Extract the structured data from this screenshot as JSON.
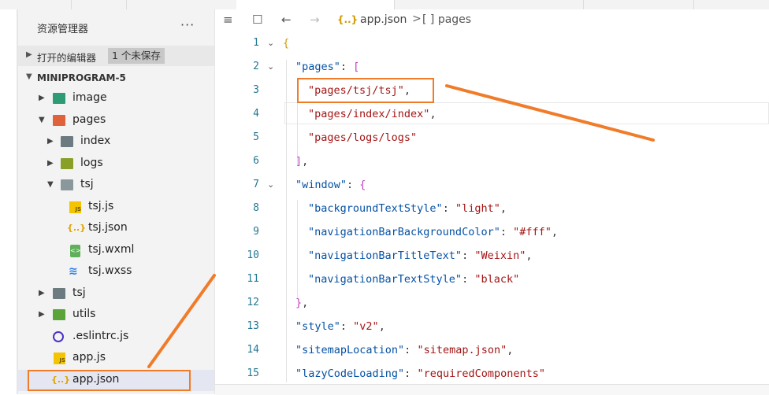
{
  "explorer": {
    "title": "资源管理器",
    "more": "···",
    "open_editors": {
      "label": "打开的编辑器",
      "badge": "1 个未保存"
    },
    "project": {
      "label": "MINIPROGRAM-5"
    },
    "tree": [
      {
        "name": "image",
        "type": "folder",
        "icon": "image-folder-icon",
        "color": "#2e9b74",
        "expanded": false
      },
      {
        "name": "pages",
        "type": "folder",
        "icon": "pages-folder-icon",
        "color": "#e0623b",
        "expanded": true
      },
      {
        "name": "index",
        "type": "folder",
        "icon": "folder-icon",
        "color": "#6c7b80",
        "expanded": false
      },
      {
        "name": "logs",
        "type": "folder",
        "icon": "logs-folder-icon",
        "color": "#88a028",
        "expanded": false
      },
      {
        "name": "tsj",
        "type": "folder",
        "icon": "folder-open-icon",
        "color": "#6c7b80",
        "expanded": true
      },
      {
        "name": "tsj.js",
        "type": "file",
        "icon": "js-file-icon"
      },
      {
        "name": "tsj.json",
        "type": "file",
        "icon": "json-file-icon"
      },
      {
        "name": "tsj.wxml",
        "type": "file",
        "icon": "wxml-file-icon"
      },
      {
        "name": "tsj.wxss",
        "type": "file",
        "icon": "wxss-file-icon"
      },
      {
        "name": "tsj",
        "type": "folder",
        "icon": "folder-icon",
        "color": "#6c7b80",
        "expanded": false
      },
      {
        "name": "utils",
        "type": "folder",
        "icon": "utils-folder-icon",
        "color": "#5aa43a",
        "expanded": false
      },
      {
        "name": ".eslintrc.js",
        "type": "file",
        "icon": "eslint-file-icon"
      },
      {
        "name": "app.js",
        "type": "file",
        "icon": "js-file-icon"
      },
      {
        "name": "app.json",
        "type": "file",
        "icon": "json-file-icon",
        "selected": true
      }
    ]
  },
  "editor": {
    "breadcrumb": {
      "file": "app.json",
      "separator": ">",
      "node": "[ ] pages"
    },
    "lines": [
      {
        "n": "1",
        "fold": true
      },
      {
        "n": "2",
        "fold": true
      },
      {
        "n": "3"
      },
      {
        "n": "4"
      },
      {
        "n": "5"
      },
      {
        "n": "6"
      },
      {
        "n": "7",
        "fold": true
      },
      {
        "n": "8"
      },
      {
        "n": "9"
      },
      {
        "n": "10"
      },
      {
        "n": "11"
      },
      {
        "n": "12"
      },
      {
        "n": "13"
      },
      {
        "n": "14"
      },
      {
        "n": "15"
      }
    ],
    "code": {
      "l1": "{",
      "l2_key": "\"pages\"",
      "l2_open": "[",
      "l3": "\"pages/tsj/tsj\"",
      "l4": "\"pages/index/index\"",
      "l5": "\"pages/logs/logs\"",
      "l6": "]",
      "l7_key": "\"window\"",
      "l7_open": "{",
      "l8_key": "\"backgroundTextStyle\"",
      "l8_val": "\"light\"",
      "l9_key": "\"navigationBarBackgroundColor\"",
      "l9_val": "\"#fff\"",
      "l10_key": "\"navigationBarTitleText\"",
      "l10_val": "\"Weixin\"",
      "l11_key": "\"navigationBarTextStyle\"",
      "l11_val": "\"black\"",
      "l12": "}",
      "l13_key": "\"style\"",
      "l13_val": "\"v2\"",
      "l14_key": "\"sitemapLocation\"",
      "l14_val": "\"sitemap.json\"",
      "l15_key": "\"lazyCodeLoading\"",
      "l15_val": "\"requiredComponents\""
    }
  },
  "colors": {
    "annotation": "#f07c2a",
    "selected_row": "#e4e6f1",
    "key": "#0451a5",
    "string": "#a31515"
  }
}
